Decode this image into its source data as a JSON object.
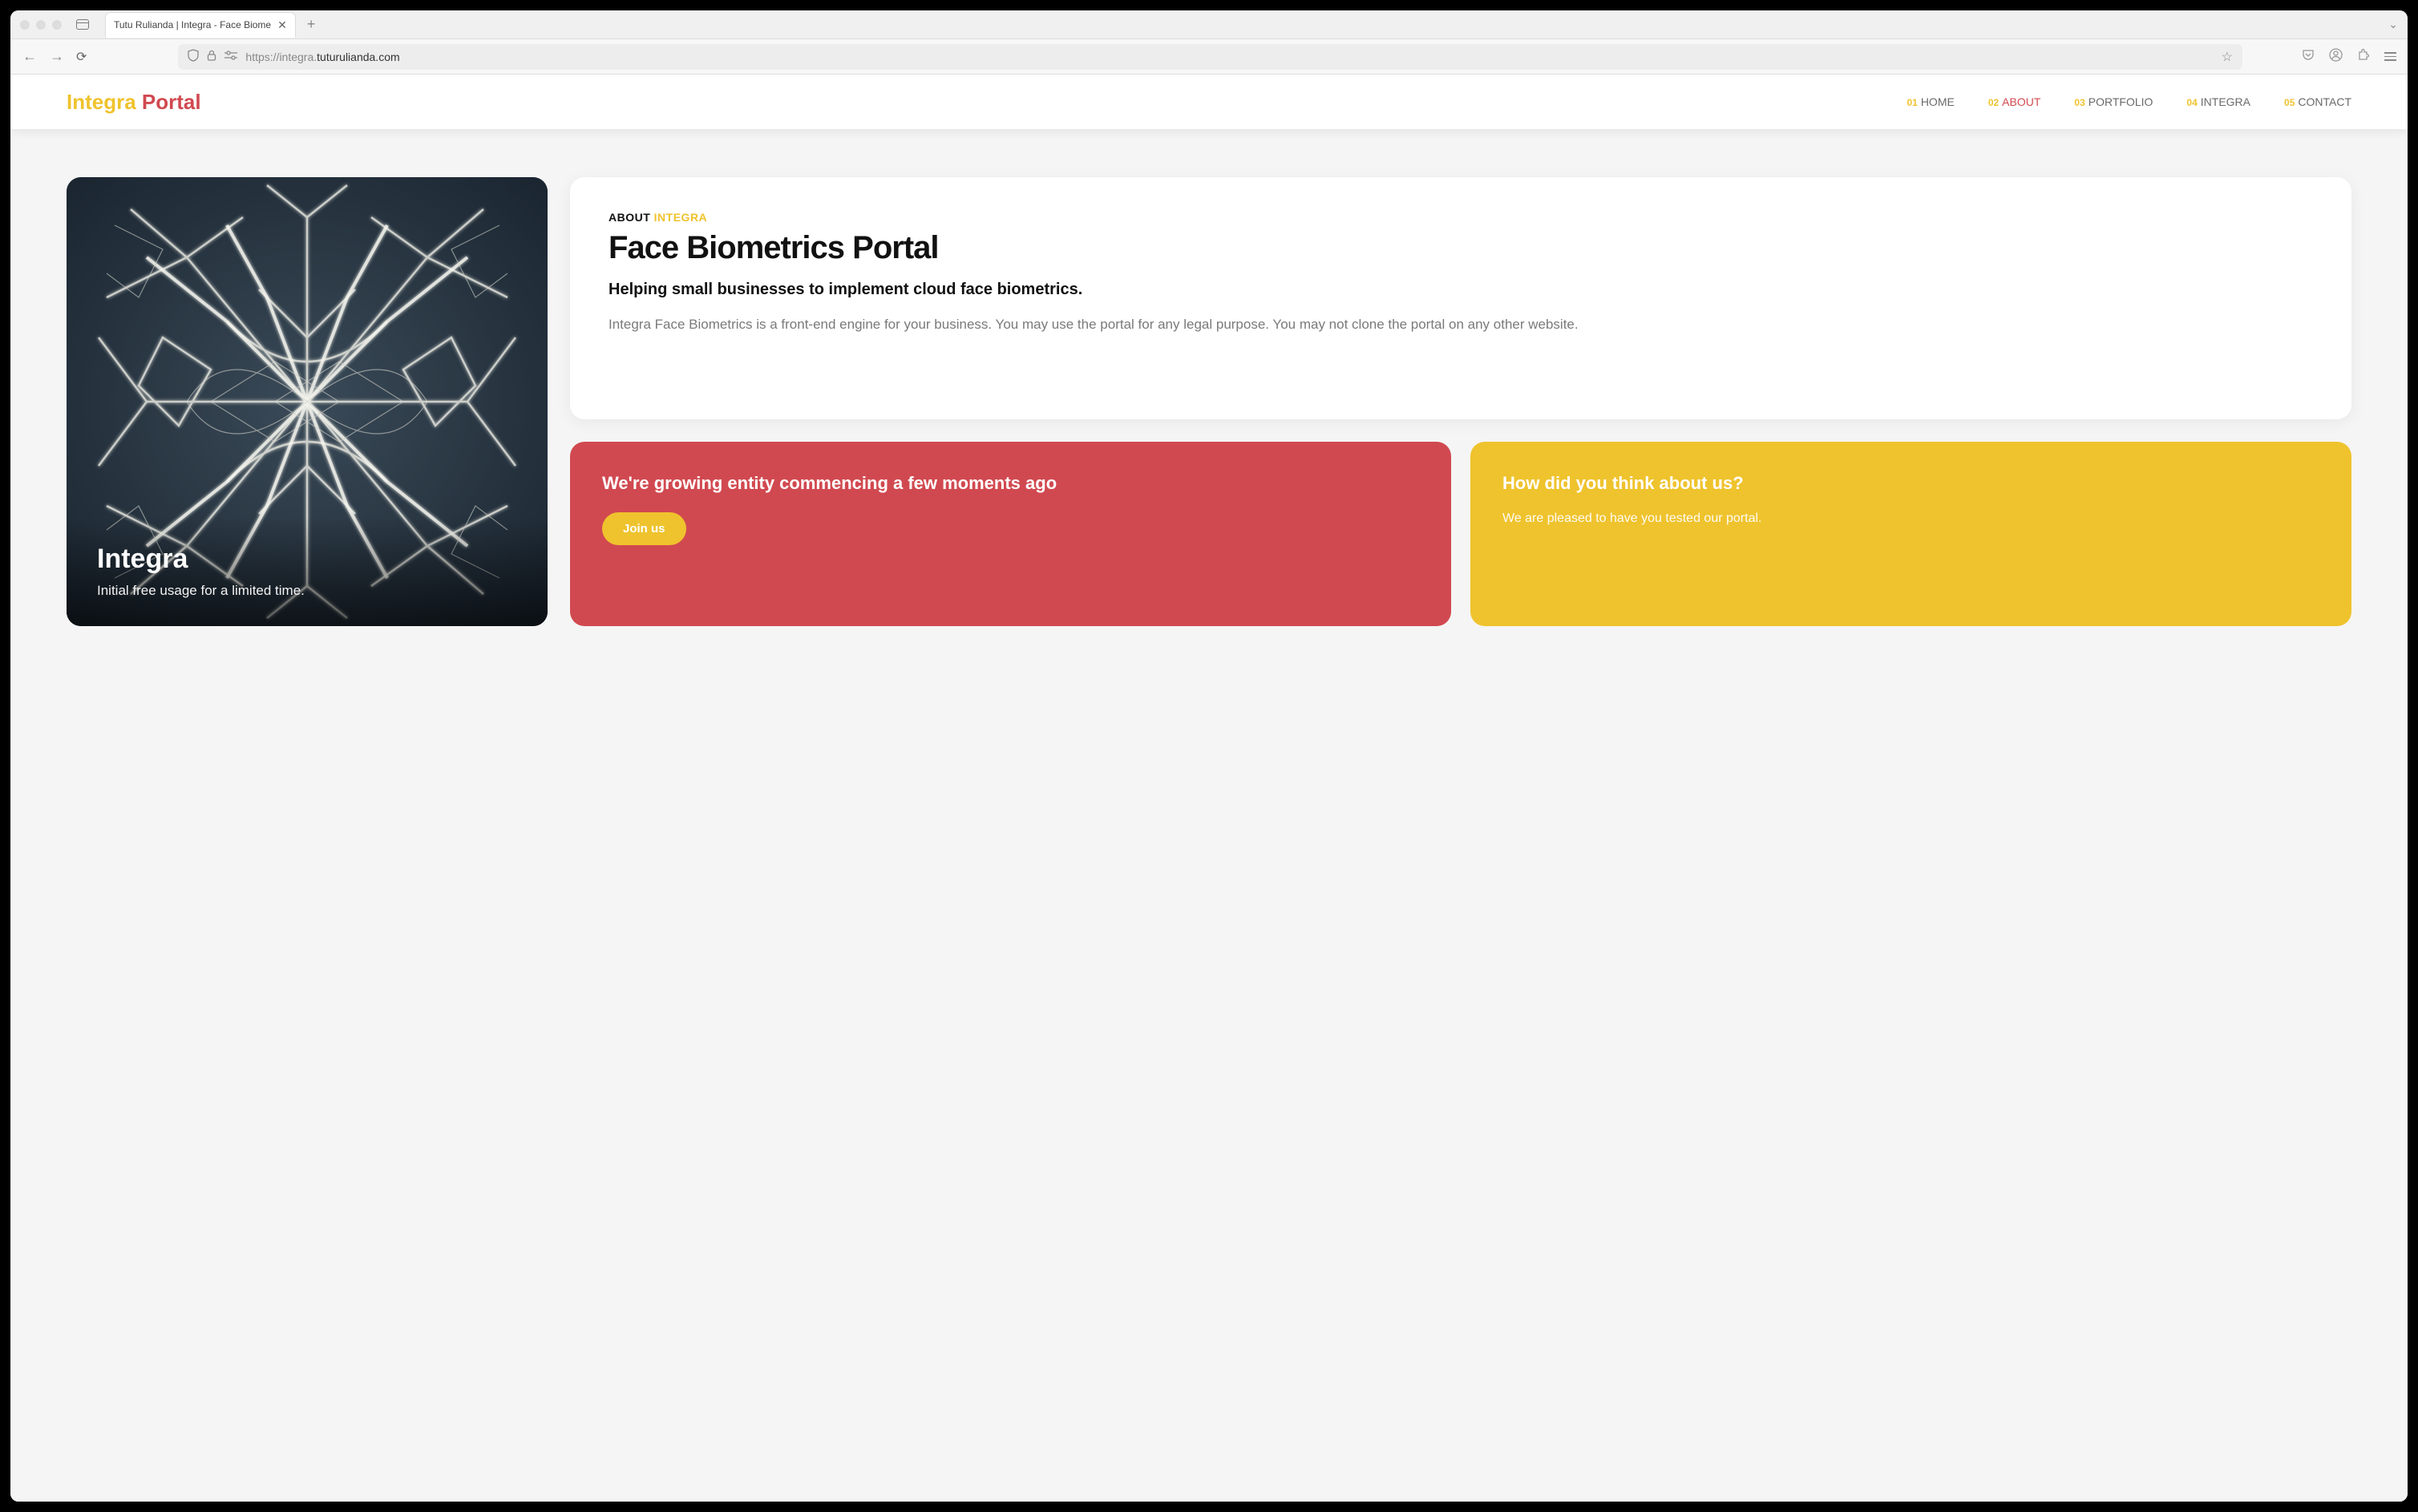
{
  "browser": {
    "tab_title": "Tutu Rulianda | Integra - Face Biome",
    "url_prefix": "https://",
    "url_sub": "integra.",
    "url_domain": "tuturulianda.com"
  },
  "header": {
    "logo_part1": "Integra ",
    "logo_part2": "Portal",
    "nav": [
      {
        "num": "01",
        "label": "HOME",
        "active": false
      },
      {
        "num": "02",
        "label": "ABOUT",
        "active": true
      },
      {
        "num": "03",
        "label": "PORTFOLIO",
        "active": false
      },
      {
        "num": "04",
        "label": "INTEGRA",
        "active": false
      },
      {
        "num": "05",
        "label": "CONTACT",
        "active": false
      }
    ]
  },
  "hero": {
    "title": "Integra",
    "subtitle": "Initial free usage for a limited time."
  },
  "about": {
    "eyebrow1": "ABOUT ",
    "eyebrow2": "INTEGRA",
    "title": "Face Biometrics Portal",
    "subtitle": "Helping small businesses to implement cloud face biometrics.",
    "body": "Integra Face Biometrics is a front-end engine for your business. You may use the portal for any legal purpose. You may not clone the portal on any other website."
  },
  "card_red": {
    "title": "We're growing entity commencing a few moments ago",
    "button": "Join us"
  },
  "card_yellow": {
    "title": "How did you think about us?",
    "body": "We are pleased to have you tested our portal."
  }
}
